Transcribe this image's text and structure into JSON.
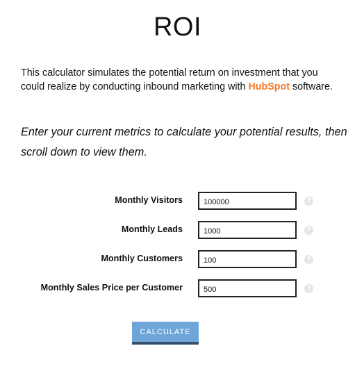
{
  "page": {
    "title": "ROI",
    "intro_before": "This calculator simulates the potential return on investment that you could realize by conducting inbound marketing with ",
    "brand_link": "HubSpot",
    "intro_after": " software.",
    "instruction": "Enter your current metrics to calculate your potential results, then scroll down to view them."
  },
  "form": {
    "fields": [
      {
        "label": "Monthly Visitors",
        "value": "100000",
        "help_icon": "question-mark"
      },
      {
        "label": "Monthly Leads",
        "value": "1000",
        "help_icon": "question-mark"
      },
      {
        "label": "Monthly Customers",
        "value": "100",
        "help_icon": "question-mark"
      },
      {
        "label": "Monthly Sales Price per Customer",
        "value": "500",
        "help_icon": "question-mark"
      }
    ],
    "help_glyph": "?",
    "submit_label": "CALCULATE"
  },
  "colors": {
    "brand": "#f07a2a",
    "button": "#6ea6da",
    "button_border": "#36506c",
    "help_icon": "#e6e6e6"
  }
}
